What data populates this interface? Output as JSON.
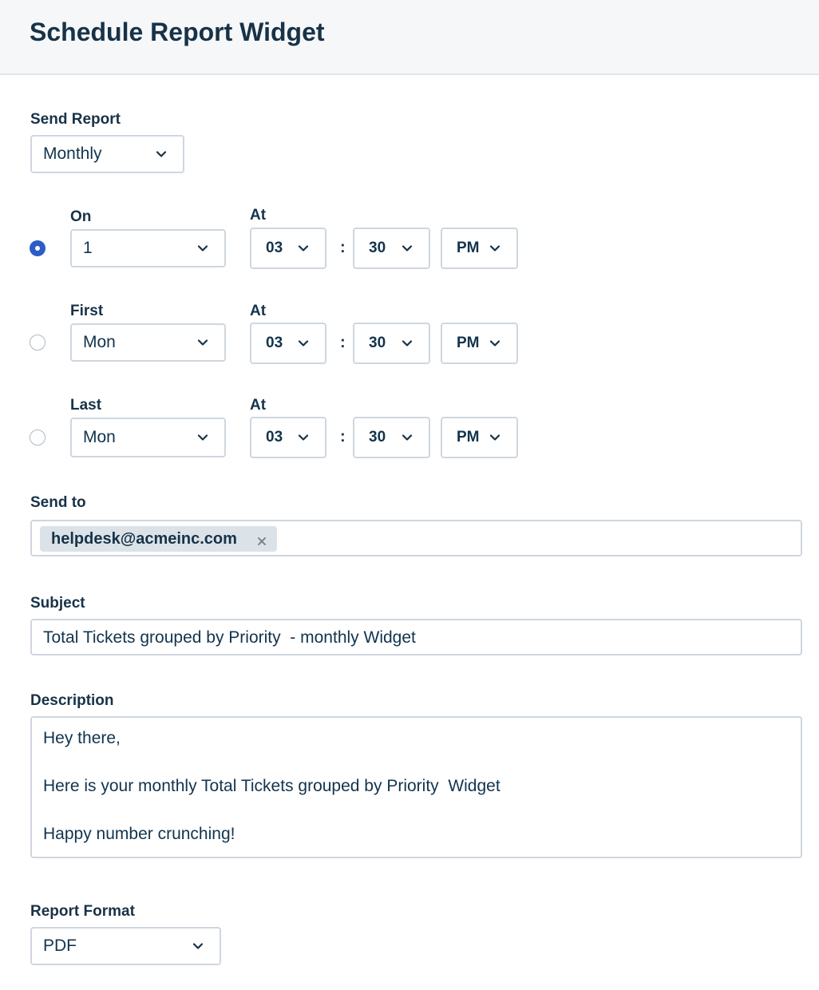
{
  "header": {
    "title": "Schedule Report Widget"
  },
  "send_report": {
    "label": "Send Report",
    "value": "Monthly"
  },
  "schedule_rows": [
    {
      "selected": true,
      "label": "On",
      "day": "1",
      "at_label": "At",
      "hour": "03",
      "colon": ":",
      "minute": "30",
      "ampm": "PM"
    },
    {
      "selected": false,
      "label": "First",
      "day": "Mon",
      "at_label": "At",
      "hour": "03",
      "colon": ":",
      "minute": "30",
      "ampm": "PM"
    },
    {
      "selected": false,
      "label": "Last",
      "day": "Mon",
      "at_label": "At",
      "hour": "03",
      "colon": ":",
      "minute": "30",
      "ampm": "PM"
    }
  ],
  "send_to": {
    "label": "Send to",
    "recipients": [
      "helpdesk@acmeinc.com"
    ]
  },
  "subject": {
    "label": "Subject",
    "value": "Total Tickets grouped by Priority  - monthly Widget"
  },
  "description": {
    "label": "Description",
    "lines": [
      "Hey there,",
      "Here is your monthly Total Tickets grouped by Priority  Widget",
      "Happy number crunching!"
    ]
  },
  "report_format": {
    "label": "Report Format",
    "value": "PDF"
  },
  "colors": {
    "accent": "#2c5cc5",
    "text": "#12344d",
    "border": "#cfd7df",
    "tag_bg": "#dbe2e8",
    "header_bg": "#f5f7f9"
  },
  "icons": {
    "dropdown": "chevron-down-icon",
    "remove": "close-icon"
  }
}
